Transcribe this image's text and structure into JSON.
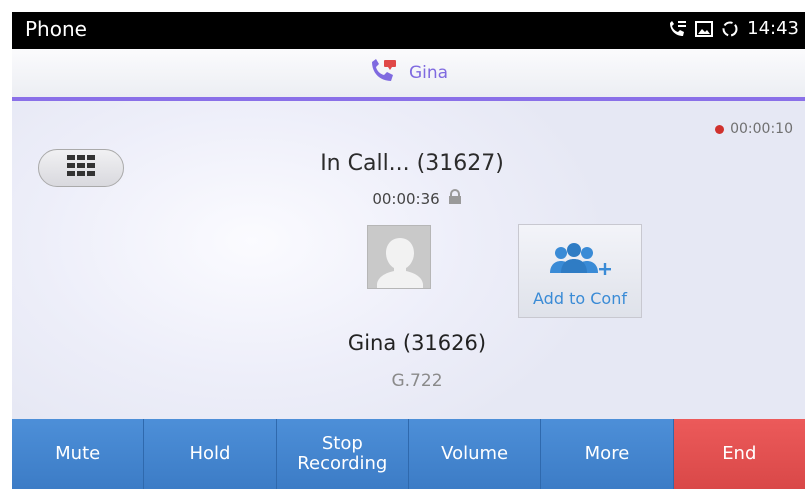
{
  "status_bar": {
    "app_name": "Phone",
    "time": "14:43",
    "icons": [
      "phone-call-icon",
      "picture-icon",
      "sync-icon"
    ]
  },
  "header": {
    "title": "Gina",
    "icon": "call-transfer-icon",
    "accent_color": "#8a70e8"
  },
  "recording": {
    "elapsed": "00:00:10",
    "dot_color": "#d0312d"
  },
  "call": {
    "state": "In Call... (31627)",
    "duration": "00:00:36",
    "lock_icon": "lock-icon",
    "contact": "Gina (31626)",
    "codec": "G.722"
  },
  "add_conf": {
    "label": "Add to Conf",
    "icon": "add-conference-icon",
    "color": "#3a8bd6"
  },
  "actions": [
    {
      "label": "Mute"
    },
    {
      "label": "Hold"
    },
    {
      "label": "Stop\nRecording"
    },
    {
      "label": "Volume"
    },
    {
      "label": "More"
    },
    {
      "label": "End"
    }
  ],
  "colors": {
    "action_blue": "#4584cf",
    "end_red": "#e05050"
  }
}
